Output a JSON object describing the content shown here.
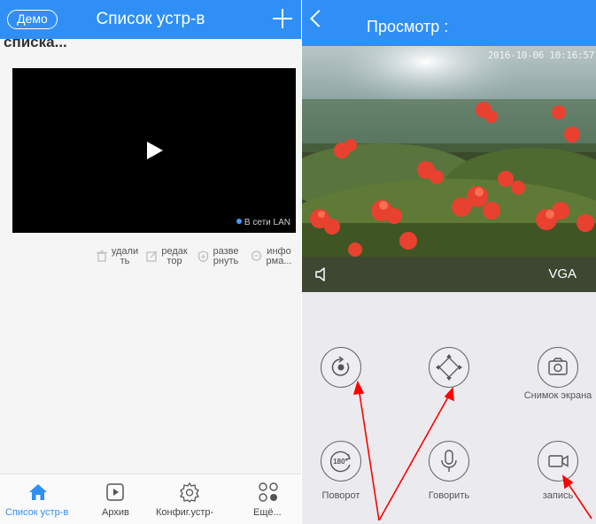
{
  "left_screen": {
    "demo_label": "Демо",
    "title": "Список устр-в",
    "clipped_header": "списка...",
    "lan_status": "В сети LAN",
    "actions": [
      {
        "icon": "trash-icon",
        "label": "удали ть"
      },
      {
        "icon": "edit-icon",
        "label": "редак тор"
      },
      {
        "icon": "expand-icon",
        "label": "разве рнуть"
      },
      {
        "icon": "info-chat-icon",
        "label": "инфо рма..."
      }
    ],
    "tabs": [
      {
        "icon": "home-icon",
        "label": "Список устр-в",
        "active": true
      },
      {
        "icon": "play-archive-icon",
        "label": "Архив",
        "active": false
      },
      {
        "icon": "gear-icon",
        "label": "Конфиг.устр-",
        "active": false
      },
      {
        "icon": "more-icon",
        "label": "Ещё...",
        "active": false
      }
    ],
    "accent_color": "#2f8ff5"
  },
  "right_screen": {
    "title": "Просмотр :",
    "timestamp": "2016-10-06 10:16:57",
    "resolution": "VGA",
    "controls": [
      {
        "icon": "rotate-icon",
        "label": ""
      },
      {
        "icon": "ptz-direction-icon",
        "label": ""
      },
      {
        "icon": "camera-icon",
        "label": "Снимок экрана"
      },
      {
        "icon": "rotate-180-icon",
        "label": "Поворот"
      },
      {
        "icon": "microphone-icon",
        "label": "Говорить"
      },
      {
        "icon": "video-record-icon",
        "label": "запись"
      }
    ]
  },
  "annotation_color": "#ff0000"
}
